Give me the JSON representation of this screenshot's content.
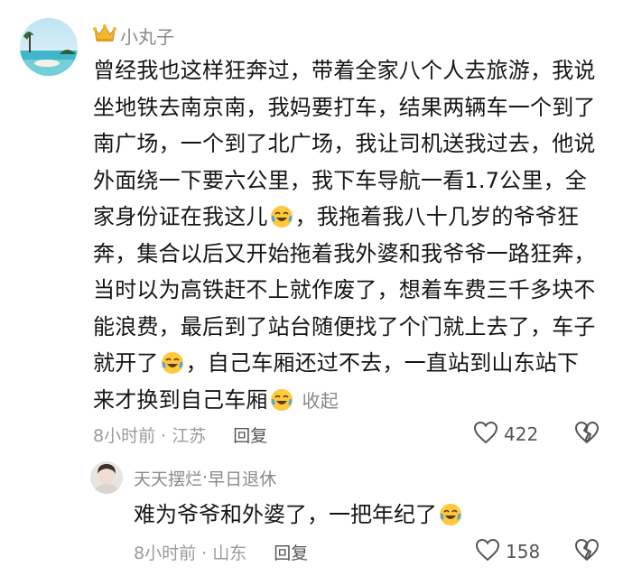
{
  "comment": {
    "author": "小丸子",
    "author_badge_icon": "crown-icon",
    "lines": [
      "曾经我也这样狂奔过，带着全家八个人去旅游，我说",
      "坐地铁去南京南，我妈要打车，结果两辆车一个到了",
      "南广场，一个到了北广场，我让司机送我过去，他说",
      "外面绕一下要六公里，我下车导航一看1.7公里，全",
      "家身份证在我这儿",
      "，我拖着我八十几岁的爷爷狂",
      "奔，集合以后又开始拖着我外婆和我爷爷一路狂奔，",
      "当时以为高铁赶不上就作废了，想着车费三千多块不",
      "能浪费，最后到了站台随便找了个门就上去了，车子",
      "就开了",
      "，自己车厢还过不去，一直站到山东站下",
      "来才换到自己车厢"
    ],
    "collapse_label": "收起",
    "time_location": "8小时前 · 江苏",
    "reply_label": "回复",
    "like_count": "422",
    "emoji_icon": "crying-laughing-emoji-icon"
  },
  "reply": {
    "author": "天天摆烂",
    "separator": " · ",
    "author_tag": "早日退休",
    "text": "难为爷爷和外婆了，一把年纪了",
    "time_location": "8小时前 · 山东",
    "reply_label": "回复",
    "like_count": "158"
  },
  "colors": {
    "text": "#161616",
    "meta": "#9a9a9a",
    "author": "#8a8a8a",
    "emoji_face": "#ffc83d"
  }
}
